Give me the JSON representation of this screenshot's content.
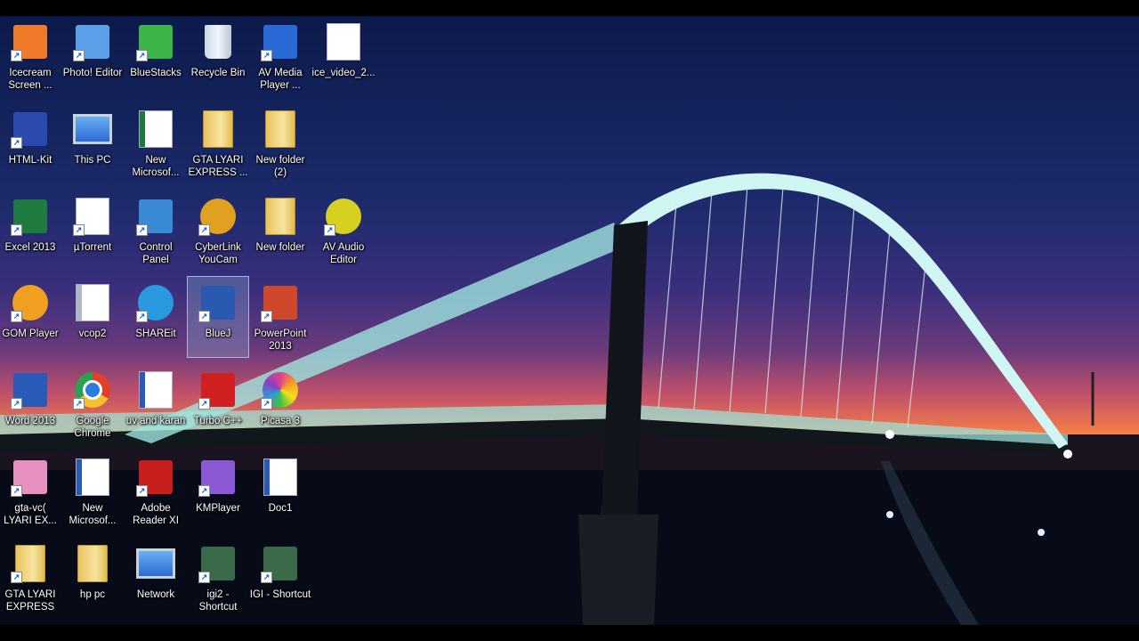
{
  "desktop": {
    "icons": [
      {
        "label": "Icecream\nScreen ...",
        "icon": "icecream-recorder-icon",
        "color": "#f07a2a",
        "shortcut": true
      },
      {
        "label": "Photo! Editor",
        "icon": "photo-editor-icon",
        "color": "#5aa0e8",
        "shortcut": true
      },
      {
        "label": "BlueStacks",
        "icon": "bluestacks-icon",
        "color": "#3bb44a",
        "shortcut": true
      },
      {
        "label": "Recycle Bin",
        "icon": "recycle-bin-icon",
        "color": "#c8d8e8",
        "shortcut": false
      },
      {
        "label": "AV Media\nPlayer ...",
        "icon": "av-media-player-icon",
        "color": "#2a6ad6",
        "shortcut": true
      },
      {
        "label": "ice_video_2...",
        "icon": "video-file-icon",
        "color": "#ffffff",
        "shortcut": false
      },
      {
        "label": "HTML-Kit",
        "icon": "html-kit-icon",
        "color": "#2a4ab0",
        "shortcut": true
      },
      {
        "label": "This PC",
        "icon": "this-pc-icon",
        "color": "#4a8ad6",
        "shortcut": false
      },
      {
        "label": "New\nMicrosof...",
        "icon": "excel-file-icon",
        "color": "#1f7a40",
        "shortcut": false
      },
      {
        "label": "GTA LYARI\nEXPRESS ...",
        "icon": "folder-icon",
        "color": "#e6c15a",
        "shortcut": false
      },
      {
        "label": "New folder\n(2)",
        "icon": "folder-icon",
        "color": "#e6c15a",
        "shortcut": false
      },
      {
        "label": "Excel 2013",
        "icon": "excel-icon",
        "color": "#1f7a40",
        "shortcut": true
      },
      {
        "label": "µTorrent",
        "icon": "utorrent-file-icon",
        "color": "#ffffff",
        "shortcut": true
      },
      {
        "label": "Control\nPanel",
        "icon": "control-panel-icon",
        "color": "#3a8ad6",
        "shortcut": true
      },
      {
        "label": "CyberLink\nYouCam",
        "icon": "cyberlink-youcam-icon",
        "color": "#e0a020",
        "shortcut": true
      },
      {
        "label": "New folder",
        "icon": "folder-icon",
        "color": "#e6c15a",
        "shortcut": false
      },
      {
        "label": "AV Audio\nEditor",
        "icon": "av-audio-editor-icon",
        "color": "#d8d020",
        "shortcut": true
      },
      {
        "label": "GOM Player",
        "icon": "gom-player-icon",
        "color": "#f0a020",
        "shortcut": true
      },
      {
        "label": "vcop2",
        "icon": "settings-file-icon",
        "color": "#b0b8c8",
        "shortcut": false
      },
      {
        "label": "SHAREit",
        "icon": "shareit-icon",
        "color": "#2a9ae0",
        "shortcut": true
      },
      {
        "label": "BlueJ",
        "icon": "bluej-icon",
        "color": "#2a5ab0",
        "shortcut": true
      },
      {
        "label": "PowerPoint\n2013",
        "icon": "powerpoint-icon",
        "color": "#d0482a",
        "shortcut": true
      },
      {
        "label": "Word 2013",
        "icon": "word-icon",
        "color": "#2a5ab8",
        "shortcut": true
      },
      {
        "label": "Google\nChrome",
        "icon": "chrome-icon",
        "color": "#e0402a",
        "shortcut": true
      },
      {
        "label": "uv and karan",
        "icon": "word-file-icon",
        "color": "#2a5ab8",
        "shortcut": false
      },
      {
        "label": "Turbo C++",
        "icon": "turbo-cpp-icon",
        "color": "#d02020",
        "shortcut": true
      },
      {
        "label": "Picasa 3",
        "icon": "picasa-icon",
        "color": "#e04090",
        "shortcut": true
      },
      {
        "label": "gta-vc(\nLYARI EX...",
        "icon": "gta-vc-icon",
        "color": "#e890c0",
        "shortcut": true
      },
      {
        "label": "New\nMicrosof...",
        "icon": "word-file-icon",
        "color": "#2a5ab8",
        "shortcut": false
      },
      {
        "label": "Adobe\nReader XI",
        "icon": "adobe-reader-icon",
        "color": "#c81e1e",
        "shortcut": true
      },
      {
        "label": "KMPlayer",
        "icon": "kmplayer-icon",
        "color": "#8a5ad6",
        "shortcut": true
      },
      {
        "label": "Doc1",
        "icon": "word-file-icon",
        "color": "#2a5ab8",
        "shortcut": false
      },
      {
        "label": "GTA LYARI\nEXPRESS",
        "icon": "folder-icon",
        "color": "#e6c15a",
        "shortcut": true
      },
      {
        "label": "hp pc",
        "icon": "user-folder-icon",
        "color": "#e6c15a",
        "shortcut": false
      },
      {
        "label": "Network",
        "icon": "network-icon",
        "color": "#3a9ad6",
        "shortcut": false
      },
      {
        "label": "igi2 -\nShortcut",
        "icon": "igi-icon",
        "color": "#3a6a4a",
        "shortcut": true
      },
      {
        "label": "IGI - Shortcut",
        "icon": "igi-icon",
        "color": "#3a6a4a",
        "shortcut": true
      }
    ],
    "selected_label": "BlueJ"
  },
  "wallpaper": {
    "subject": "",
    "colors": {
      "sky_top": "#0c1a4a",
      "sunset": "#ff8f3a",
      "water": "#0b0f20",
      "bridge_light": "#bff5ee"
    }
  }
}
